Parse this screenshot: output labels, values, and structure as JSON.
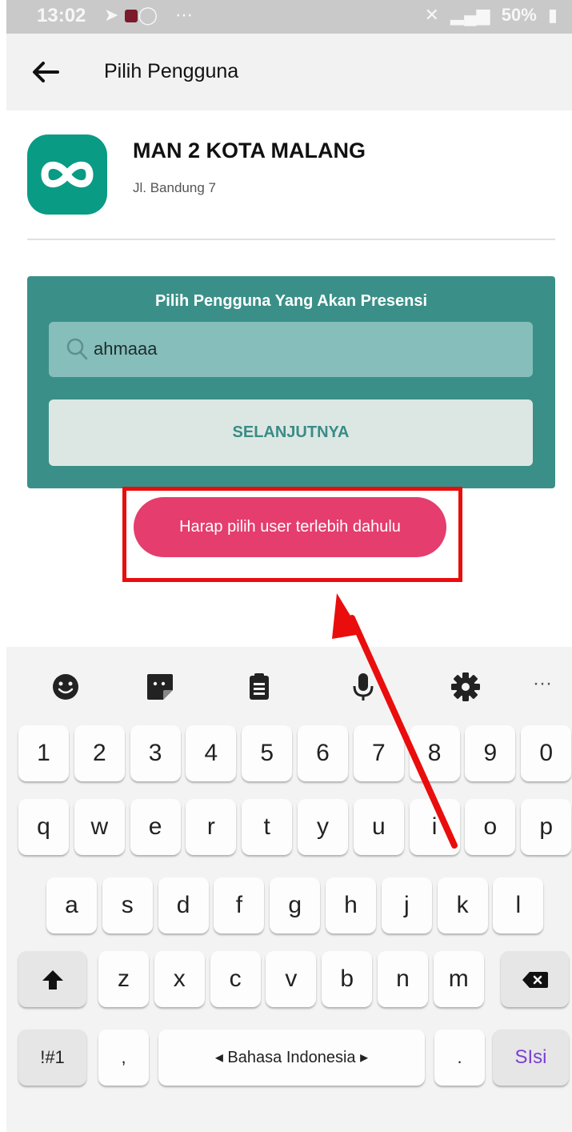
{
  "status_bar": {
    "time": "13:02",
    "battery": "50%"
  },
  "app_bar": {
    "title": "Pilih Pengguna",
    "back_icon": "arrow-left-icon"
  },
  "school": {
    "name": "MAN 2 KOTA MALANG",
    "address": "Jl. Bandung 7",
    "logo_icon": "infinity-logo"
  },
  "panel": {
    "title": "Pilih Pengguna Yang Akan Presensi",
    "search_value": "ahmaaa",
    "next_label": "SELANJUTNYA",
    "color": "#3a9088"
  },
  "toast": {
    "message": "Harap pilih user terlebih dahulu",
    "color": "#e43d6e"
  },
  "annotation": {
    "color": "#ea0d0d"
  },
  "keyboard": {
    "toolbar_icons": [
      "emoji-icon",
      "sticker-icon",
      "clipboard-icon",
      "microphone-icon",
      "gear-icon",
      "more-icon"
    ],
    "more_label": "···",
    "number_row": [
      "1",
      "2",
      "3",
      "4",
      "5",
      "6",
      "7",
      "8",
      "9",
      "0"
    ],
    "row1": [
      "q",
      "w",
      "e",
      "r",
      "t",
      "y",
      "u",
      "i",
      "o",
      "p"
    ],
    "row2": [
      "a",
      "s",
      "d",
      "f",
      "g",
      "h",
      "j",
      "k",
      "l"
    ],
    "row3": [
      "z",
      "x",
      "c",
      "v",
      "b",
      "n",
      "m"
    ],
    "symbols_label": "!#1",
    "comma": ",",
    "space_label": "◂ Bahasa Indonesia ▸",
    "period": ".",
    "enter_label": "SIsi"
  }
}
